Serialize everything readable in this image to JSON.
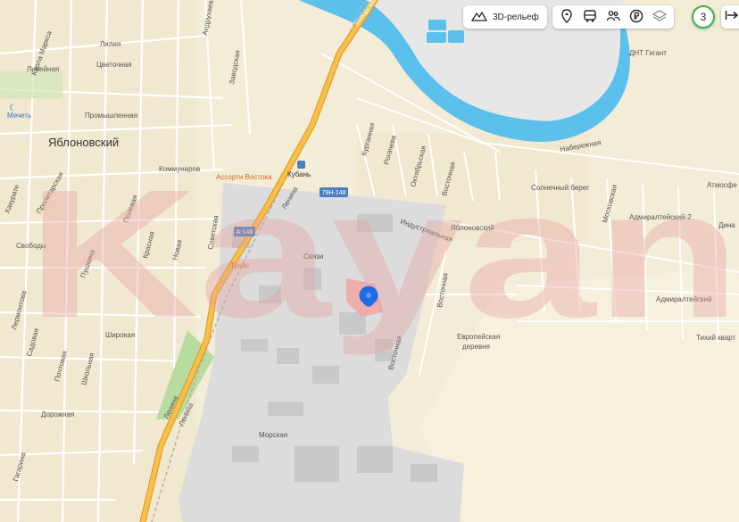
{
  "toolbar": {
    "relief_label": "3D-рельеф",
    "zoom_badge": "3",
    "icons": [
      "relief-icon",
      "poi-icon",
      "transport-icon",
      "people-icon",
      "ruble-icon",
      "layers-icon",
      "exit-icon"
    ]
  },
  "map": {
    "town": "Яблоновский",
    "places": {
      "mosque": "Мечеть",
      "station": "Кубань",
      "shop": "Ассорти Востока",
      "shop2": "Тунас",
      "dnt": "ДНТ Гигант",
      "solnechny": "Солнечный берег",
      "admiralteysky2": "Адмиралтейский-2",
      "admiralteysky": "Адмиралтейский",
      "tikhy": "Тихий кварт",
      "atmosfera": "Атмосфе",
      "dinastia": "Дина",
      "yablonovsky_zone": "Яблоновский",
      "evropeiskaya1": "Европейская",
      "evropeiskaya2": "деревня"
    },
    "streets": {
      "karl_marx": "Карла Маркса",
      "tsvetochnaya": "Цветочная",
      "liliya": "Лилия",
      "lineynaya": "Линейная",
      "promyshlennaya": "Промышленная",
      "andrukhaeva": "Андрухаева",
      "zavodskaya": "Заводская",
      "kommunarov": "Коммунаров",
      "proletarskaya": "Пролетарская",
      "khakurate": "Хакурате",
      "polevaya": "Полевая",
      "svobody": "Свободы",
      "krasnaya": "Красная",
      "pushkina": "Пушкина",
      "novaya": "Новая",
      "sovetskaya": "Советская",
      "lenina": "Ленина",
      "lermontova": "Лермонтова",
      "shirokaya": "Широкая",
      "sadovaya": "Садовая",
      "pochtovaya": "Почтовая",
      "shkolnaya": "Школьная",
      "dorozhnaya": "Дорожная",
      "gagarina": "Гагарина",
      "morskaya": "Морская",
      "svyazi": "Связи",
      "kurgana": "Курганная",
      "rogacheva": "Рогачева",
      "oktyabrskaya": "Октябрьская",
      "vostochnaya": "Восточная",
      "industrialnaya": "Индустриальная",
      "naberezhnaya": "Набережная",
      "moskovskaya": "Московская",
      "zavodskaya2": "Заводская"
    },
    "shields": {
      "a146": "А-146",
      "r148": "79Н-148"
    }
  },
  "watermark": "Kayan",
  "colors": {
    "land": "#f3ecd6",
    "water": "#5bc0eb",
    "highway": "#f5a623",
    "industrial": "#dcdcdc",
    "marker": "#1e6de6",
    "zoom_ring": "#3bb54a"
  }
}
